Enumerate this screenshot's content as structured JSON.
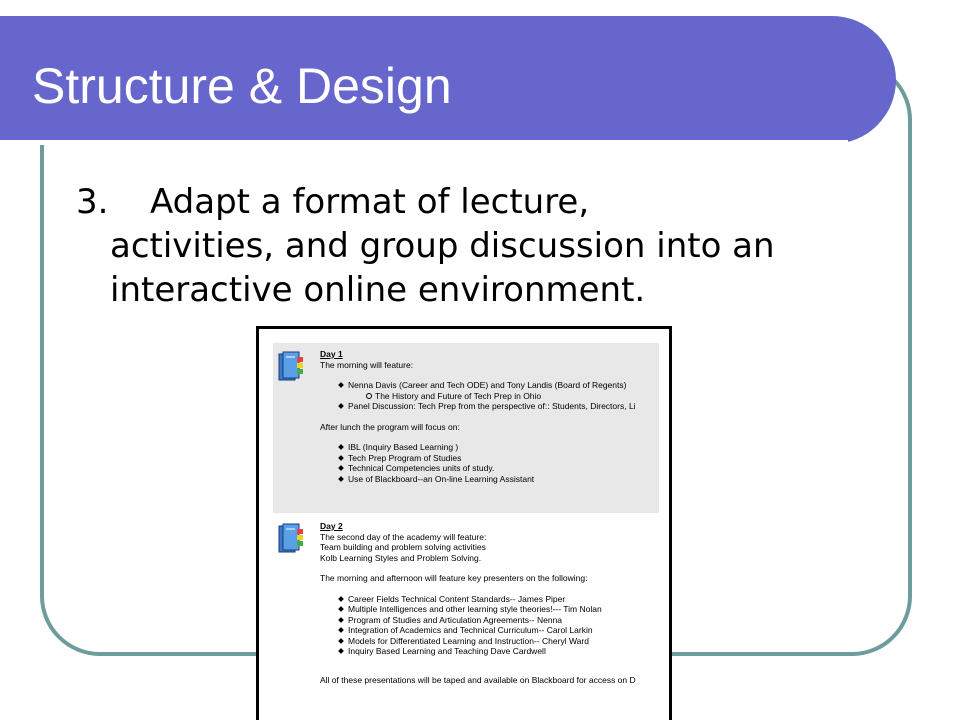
{
  "slide": {
    "title": "Structure & Design",
    "point_number": "3.",
    "point_lines": [
      "Adapt a format of lecture,",
      "activities, and group discussion into an",
      "interactive online environment."
    ]
  },
  "screenshot": {
    "day1": {
      "heading": "Day 1",
      "intro": "The morning will feature:",
      "items": [
        "Nenna Davis (Career and Tech ODE) and Tony Landis (Board of Regents)",
        "Panel Discussion: Tech Prep from the perspective of:: Students, Directors, Li"
      ],
      "subitem": "The History and Future of Tech Prep in Ohio",
      "after_lunch": "After lunch the program will focus on:",
      "afternoon_items": [
        "IBL (Inquiry Based Learning )",
        "Tech Prep Program of Studies",
        "Technical Competencies units of study.",
        "Use of Blackboard--an On-line Learning Assistant"
      ]
    },
    "day2": {
      "heading": "Day 2",
      "intro_lines": [
        "The second day of the academy will feature:",
        "Team building and problem solving activities",
        "Kolb Learning Styles and Problem Solving."
      ],
      "presenters_intro": "The morning and afternoon will feature key presenters on the following:",
      "items": [
        "Career Fields Technical Content Standards-- James Piper",
        "Multiple Intelligences and other learning style theories!--- Tim Nolan",
        "Program of Studies and Articulation Agreements-- Nenna",
        "Integration of Academics and Technical Curriculum-- Carol Larkin",
        "Models for Differentiated Learning and Instruction-- Cheryl Ward",
        "Inquiry Based Learning and Teaching Dave Cardwell"
      ],
      "footer": "All of these presentations will be taped and available on Blackboard for access on D"
    }
  },
  "colors": {
    "title_bar": "#6666cc",
    "frame_border": "#6e9c9c",
    "panel_background": "#e8e8e8"
  },
  "icons": [
    "book-icon"
  ]
}
